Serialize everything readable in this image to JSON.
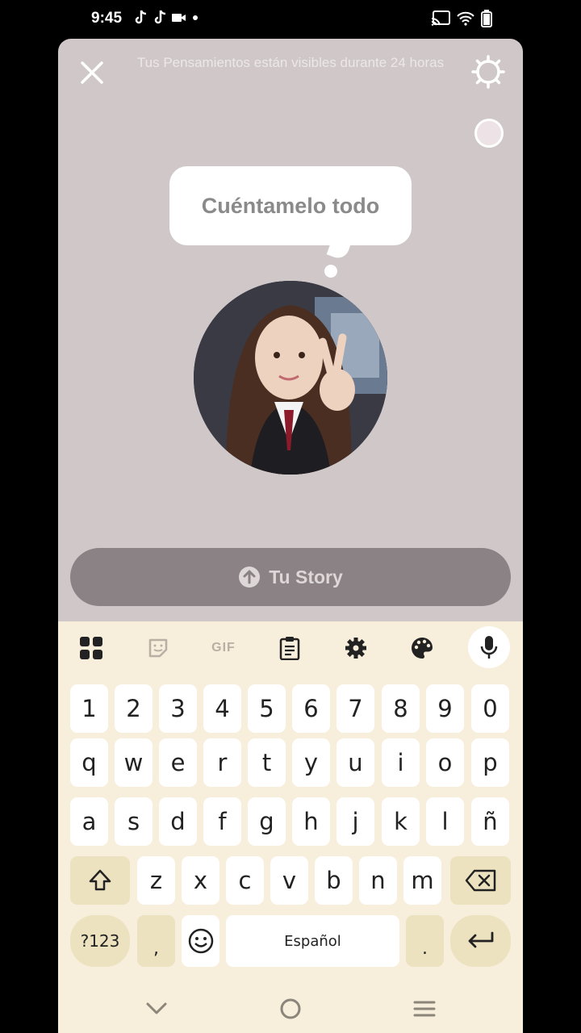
{
  "status_bar": {
    "time": "9:45",
    "icons_left": [
      "tiktok-icon",
      "tiktok-icon",
      "video-icon",
      "dot-icon"
    ],
    "icons_right": [
      "cast-icon",
      "wifi-icon",
      "battery-icon"
    ]
  },
  "header": {
    "visibility_text": "Tus Pensamientos están visibles durante 24 horas"
  },
  "thought": {
    "placeholder": "Cuéntamelo todo"
  },
  "story_button": {
    "label": "Tu Story"
  },
  "keyboard": {
    "toolbar": [
      "apps-icon",
      "sticker-icon",
      "GIF",
      "clipboard-icon",
      "gear-icon",
      "palette-icon",
      "mic-icon"
    ],
    "gif_label": "GIF",
    "row_numbers": [
      "1",
      "2",
      "3",
      "4",
      "5",
      "6",
      "7",
      "8",
      "9",
      "0"
    ],
    "row1": [
      "q",
      "w",
      "e",
      "r",
      "t",
      "y",
      "u",
      "i",
      "o",
      "p"
    ],
    "row2": [
      "a",
      "s",
      "d",
      "f",
      "g",
      "h",
      "j",
      "k",
      "l",
      "ñ"
    ],
    "row3": [
      "z",
      "x",
      "c",
      "v",
      "b",
      "n",
      "m"
    ],
    "symbols_label": "?123",
    "comma_label": ",",
    "space_label": "Español",
    "period_label": "."
  },
  "colors": {
    "panel_bg": "#cfc7c8",
    "story_button_bg": "#8a8284",
    "keyboard_bg": "#f7eedb",
    "func_key_bg": "#ece2bf"
  }
}
